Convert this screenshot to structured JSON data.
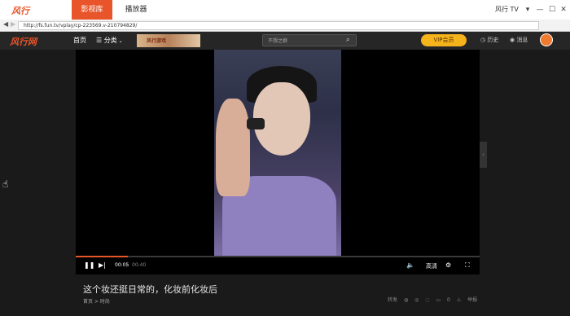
{
  "app": {
    "logo": "风行",
    "tabs": [
      "影视库",
      "播放器"
    ],
    "brand": "风行 TV",
    "window_controls": [
      "▾",
      "—",
      "☐",
      "✕"
    ]
  },
  "address": {
    "url": "http://fs.fun.tv/vplay/cp-223569.v-210794829/"
  },
  "site": {
    "logo": "风行网",
    "nav_home": "首页",
    "nav_category": "分类",
    "promo": "风行游戏",
    "search_placeholder": "不想之娘",
    "vip": "VIP会员",
    "history": "历史",
    "message": "消息"
  },
  "player": {
    "current_time": "00:05",
    "separator": "/",
    "total_time": "00:40",
    "quality": "高清",
    "progress": 0.13
  },
  "video": {
    "title": "这个妆还挺日常的，化妆前化妆后",
    "breadcrumb": "首页 > 时尚",
    "meta": {
      "repost": "转发",
      "comments": "0",
      "report": "举报"
    }
  },
  "colors": {
    "accent": "#e8552a",
    "vip": "#f5b31c"
  }
}
